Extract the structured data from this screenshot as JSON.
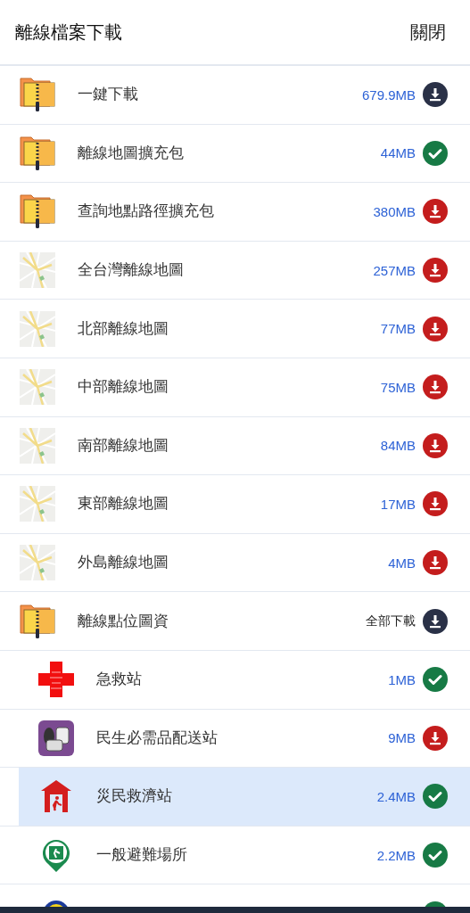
{
  "header": {
    "title": "離線檔案下載",
    "close_button": "關閉"
  },
  "items": [
    {
      "kind": "bundle",
      "name": "一鍵下載",
      "size": "679.9MB",
      "downloaded": false,
      "selected": false
    },
    {
      "kind": "archive",
      "name": "離線地圖擴充包",
      "size": "44MB",
      "downloaded": true,
      "selected": false
    },
    {
      "kind": "archive",
      "name": "查詢地點路徑擴充包",
      "size": "380MB",
      "downloaded": false,
      "selected": false
    },
    {
      "kind": "map",
      "name": "全台灣離線地圖",
      "size": "257MB",
      "downloaded": false,
      "selected": false
    },
    {
      "kind": "map",
      "name": "北部離線地圖",
      "size": "77MB",
      "downloaded": false,
      "selected": false
    },
    {
      "kind": "map",
      "name": "中部離線地圖",
      "size": "75MB",
      "downloaded": false,
      "selected": false
    },
    {
      "kind": "map",
      "name": "南部離線地圖",
      "size": "84MB",
      "downloaded": false,
      "selected": false
    },
    {
      "kind": "map",
      "name": "東部離線地圖",
      "size": "17MB",
      "downloaded": false,
      "selected": false
    },
    {
      "kind": "map",
      "name": "外島離線地圖",
      "size": "4MB",
      "downloaded": false,
      "selected": false
    },
    {
      "kind": "bundle",
      "name": "離線點位圖資",
      "size": "全部下載",
      "downloaded": false,
      "selected": false,
      "children": [
        {
          "kind": "first-aid",
          "name": "急救站",
          "size": "1MB",
          "downloaded": true,
          "selected": false
        },
        {
          "kind": "supplies",
          "name": "民生必需品配送站",
          "size": "9MB",
          "downloaded": false,
          "selected": false
        },
        {
          "kind": "relief-station",
          "name": "災民救濟站",
          "size": "2.4MB",
          "downloaded": true,
          "selected": true
        },
        {
          "kind": "shelter",
          "name": "一般避難場所",
          "size": "2.2MB",
          "downloaded": true,
          "selected": false
        },
        {
          "kind": "badge",
          "downloaded": true,
          "selected": false
        }
      ]
    }
  ]
}
